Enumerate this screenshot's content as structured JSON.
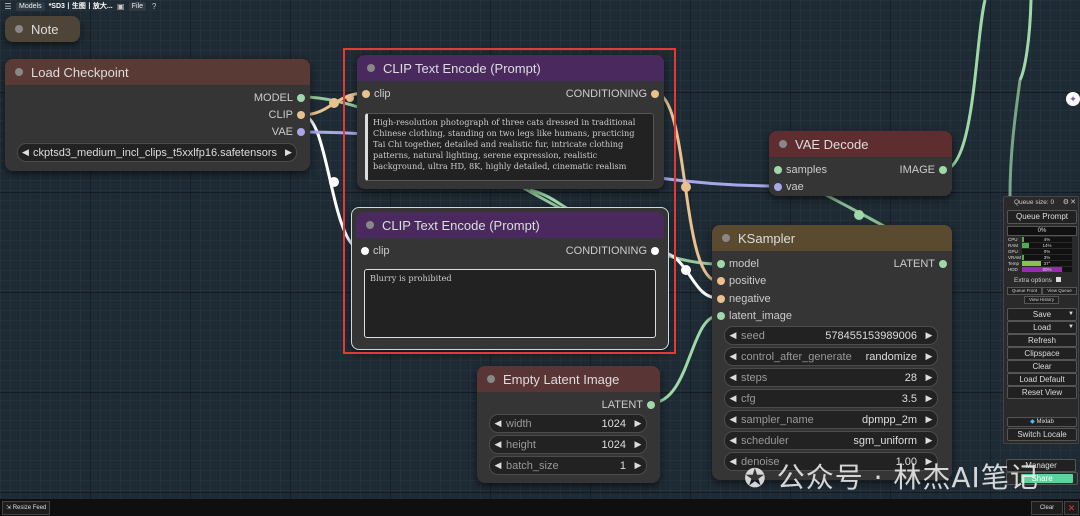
{
  "toolbar": {
    "models_label": "Models",
    "workflow_title": "*SD3丨生图丨放大...",
    "file_menu": "File"
  },
  "nodes": {
    "note": {
      "title": "Note"
    },
    "load_checkpoint": {
      "title": "Load Checkpoint",
      "outputs": [
        "MODEL",
        "CLIP",
        "VAE"
      ],
      "ckpt_name": "ckptsd3_medium_incl_clips_t5xxlfp16.safetensors"
    },
    "clip_positive": {
      "title": "CLIP Text Encode (Prompt)",
      "input": "clip",
      "output": "CONDITIONING",
      "text": "High-resolution photograph of three cats dressed in traditional Chinese clothing, standing on two legs like humans, practicing Tai Chi together, detailed and realistic fur, intricate clothing patterns, natural lighting, serene expression, realistic background, ultra HD, 8K, highly detailed, cinematic realism"
    },
    "clip_negative": {
      "title": "CLIP Text Encode (Prompt)",
      "input": "clip",
      "output": "CONDITIONING",
      "text": "Blurry is prohibited"
    },
    "vae_decode": {
      "title": "VAE Decode",
      "inputs": [
        "samples",
        "vae"
      ],
      "output": "IMAGE"
    },
    "ksampler": {
      "title": "KSampler",
      "inputs": [
        "model",
        "positive",
        "negative",
        "latent_image"
      ],
      "output": "LATENT",
      "widgets": [
        {
          "label": "seed",
          "value": "578455153989006"
        },
        {
          "label": "control_after_generate",
          "value": "randomize"
        },
        {
          "label": "steps",
          "value": "28"
        },
        {
          "label": "cfg",
          "value": "3.5"
        },
        {
          "label": "sampler_name",
          "value": "dpmpp_2m"
        },
        {
          "label": "scheduler",
          "value": "sgm_uniform"
        },
        {
          "label": "denoise",
          "value": "1.00"
        }
      ]
    },
    "empty_latent": {
      "title": "Empty Latent Image",
      "output": "LATENT",
      "widgets": [
        {
          "label": "width",
          "value": "1024"
        },
        {
          "label": "height",
          "value": "1024"
        },
        {
          "label": "batch_size",
          "value": "1"
        }
      ]
    }
  },
  "panel": {
    "queue_size": "Queue size: 0",
    "queue_prompt": "Queue Prompt",
    "progress": "0%",
    "progress_fraction": 0,
    "monitors": [
      {
        "label": "CPU",
        "value": "4%",
        "fraction": 0.04,
        "color": "#4caf50"
      },
      {
        "label": "RAM",
        "value": "14%",
        "fraction": 0.14,
        "color": "#4caf50"
      },
      {
        "label": "GPU",
        "value": "0%",
        "fraction": 0.0,
        "color": "#4caf50"
      },
      {
        "label": "VRAM",
        "value": "3%",
        "fraction": 0.03,
        "color": "#4caf50"
      },
      {
        "label": "Temp",
        "value": "37°",
        "fraction": 0.37,
        "color": "#8bc34a"
      },
      {
        "label": "HDD",
        "value": "80%",
        "fraction": 0.8,
        "color": "#9c27b0"
      }
    ],
    "extra_options": "Extra options",
    "queue_front": "Queue Front",
    "view_queue": "View Queue",
    "view_history": "View History",
    "save": "Save",
    "load": "Load",
    "refresh": "Refresh",
    "clipspace": "Clipspace",
    "clear": "Clear",
    "load_default": "Load Default",
    "reset_view": "Reset View",
    "mixlab": "Mixlab",
    "switch_locale": "Switch Locale",
    "manager": "Manager",
    "share": "Share"
  },
  "bottom": {
    "resize_feed": "Resize Feed",
    "clear": "Clear"
  },
  "watermark": "公众号 · 林杰AI笔记",
  "colors": {
    "clip_header": "#4a2a5e",
    "load_header": "#5a3a35",
    "vae_header": "#5e2d30",
    "ksampler_header": "#5a4a30",
    "latent_header": "#5a3535",
    "note_header": "#4e4438",
    "highlight_box": "#e53935"
  }
}
